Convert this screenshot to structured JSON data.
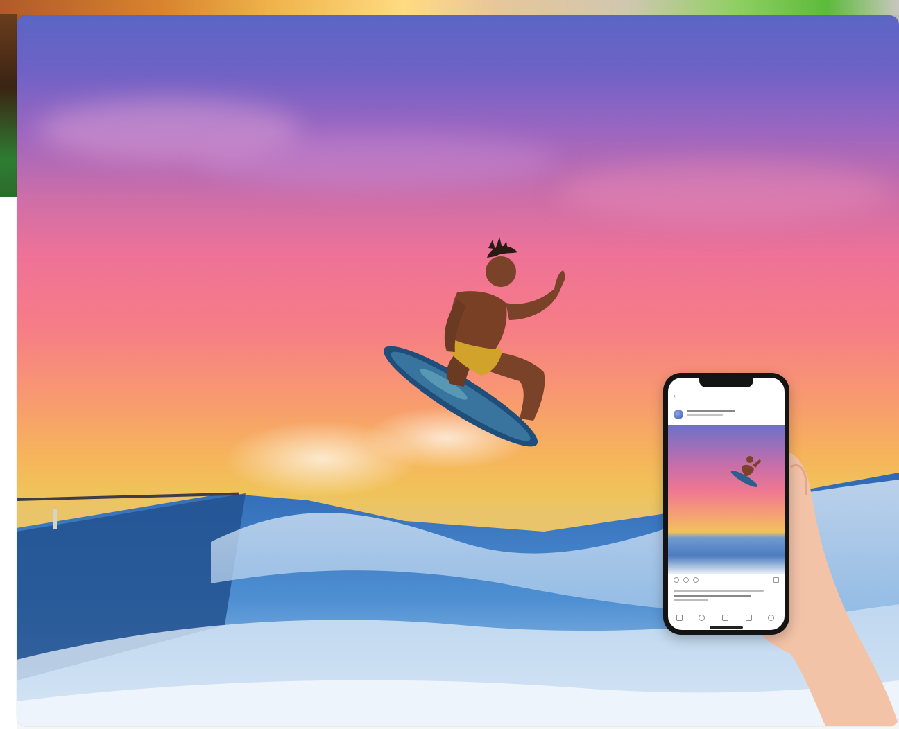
{
  "page": {
    "background_color": "#f4f5f7"
  },
  "hero": {
    "description": "",
    "accent_colors": {
      "sky_top": "#5a66c4",
      "sky_mid": "#ef7297",
      "sky_low": "#f6b45b",
      "water": "#3a78c2"
    }
  },
  "phone": {
    "status_time": "",
    "status_icons": "",
    "app_title": "",
    "back_glyph": "‹"
  },
  "icons": {
    "avatar": "avatar-icon",
    "heart": "heart-icon",
    "comment": "comment-icon",
    "share": "share-icon",
    "save": "bookmark-icon",
    "home": "home-icon",
    "search": "search-icon",
    "add": "add-icon",
    "reels": "reels-icon",
    "profile": "profile-icon"
  }
}
